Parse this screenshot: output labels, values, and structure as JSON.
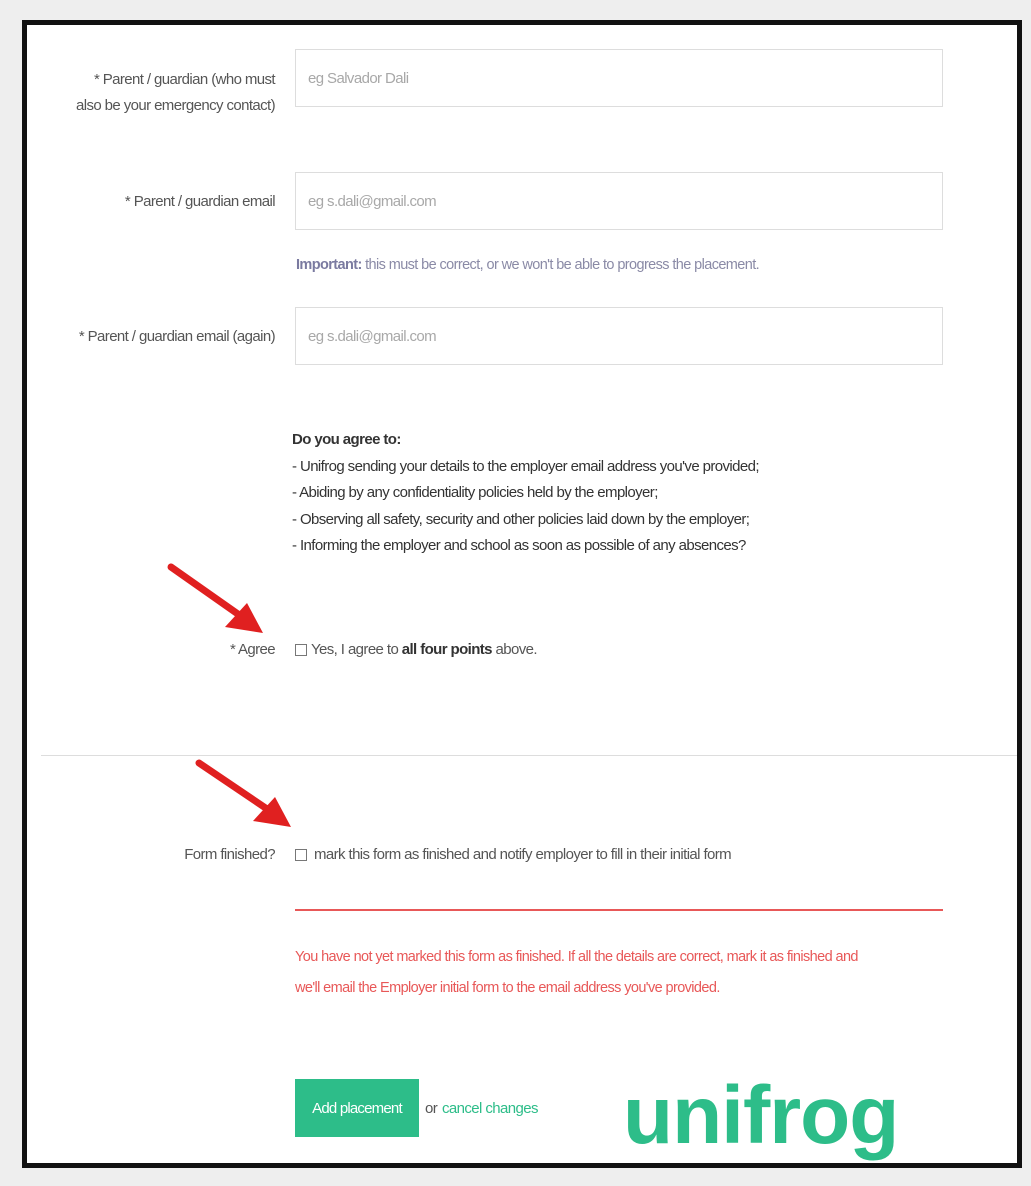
{
  "form": {
    "guardian_name": {
      "label_line1": "* Parent / guardian (who must",
      "label_line2": "also be your emergency contact)",
      "placeholder": "eg Salvador Dali",
      "value": ""
    },
    "guardian_email": {
      "label": "* Parent / guardian email",
      "placeholder": "eg s.dali@gmail.com",
      "value": ""
    },
    "important_note": {
      "strong": "Important:",
      "text": " this must be correct, or we won't be able to progress the placement."
    },
    "guardian_email_again": {
      "label": "* Parent / guardian email (again)",
      "placeholder": "eg s.dali@gmail.com",
      "value": ""
    },
    "agreement": {
      "heading": "Do you agree to:",
      "points": [
        "- Unifrog sending your details to the employer email address you've provided;",
        "- Abiding by any confidentiality policies held by the employer;",
        "- Observing all safety, security and other policies laid down by the employer;",
        "- Informing the employer and school as soon as possible of any absences?"
      ],
      "label": "* Agree",
      "checkbox_pre": "Yes, I agree to ",
      "checkbox_bold": "all four points",
      "checkbox_post": " above.",
      "checked": false
    },
    "form_finished": {
      "label": "Form finished?",
      "checkbox_text": "mark this form as finished and notify employer to fill in their initial form",
      "checked": false,
      "error_line1": "You have not yet marked this form as finished. If all the details are correct, mark it as finished and",
      "error_line2": "we'll email the Employer initial form to the email address you've provided."
    },
    "actions": {
      "submit_label": "Add placement",
      "or_text": "or",
      "cancel_label": "cancel changes"
    }
  },
  "brand": {
    "logo_text": "unifrog",
    "accent_color": "#2dbd89",
    "error_color": "#e85858",
    "arrow_color": "#e02020"
  },
  "annotations": {
    "arrows": [
      "red-arrow-icon",
      "red-arrow-icon"
    ]
  }
}
